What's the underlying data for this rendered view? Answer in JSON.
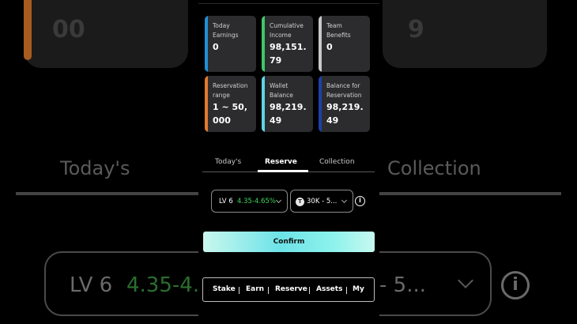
{
  "cards": [
    {
      "label": "Today Earnings",
      "value": "0",
      "color": "#1e90d6"
    },
    {
      "label": "Cumulative Income",
      "value": "98,151.79",
      "color": "#3ec86a"
    },
    {
      "label": "Team Benefits",
      "value": "0",
      "color": "#c8c8c8"
    },
    {
      "label": "Reservation range",
      "value": "1 ~ 50,000",
      "color": "#e07a2a"
    },
    {
      "label": "Wallet Balance",
      "value": "98,219.49",
      "color": "#5fd4e8"
    },
    {
      "label": "Balance for Reservation",
      "value": "98,219.49",
      "color": "#1f3fa8"
    }
  ],
  "tabs": [
    {
      "label": "Today's",
      "active": false
    },
    {
      "label": "Reserve",
      "active": true
    },
    {
      "label": "Collection",
      "active": false
    }
  ],
  "level_select": {
    "level": "LV 6",
    "rate": "4.35-4.65%"
  },
  "amount_select": {
    "coin_icon": "tether-icon",
    "value": "30K - 5..."
  },
  "confirm_label": "Confirm",
  "bottom_nav": [
    "Stake",
    "Earn",
    "Reserve",
    "Assets",
    "My"
  ],
  "background": {
    "card_value": "00",
    "card_value_right": "9",
    "tab_left": "Today's",
    "tab_right": "Collection",
    "level": "LV 6",
    "rate": "4.35-4.",
    "amount": "- 5..."
  }
}
